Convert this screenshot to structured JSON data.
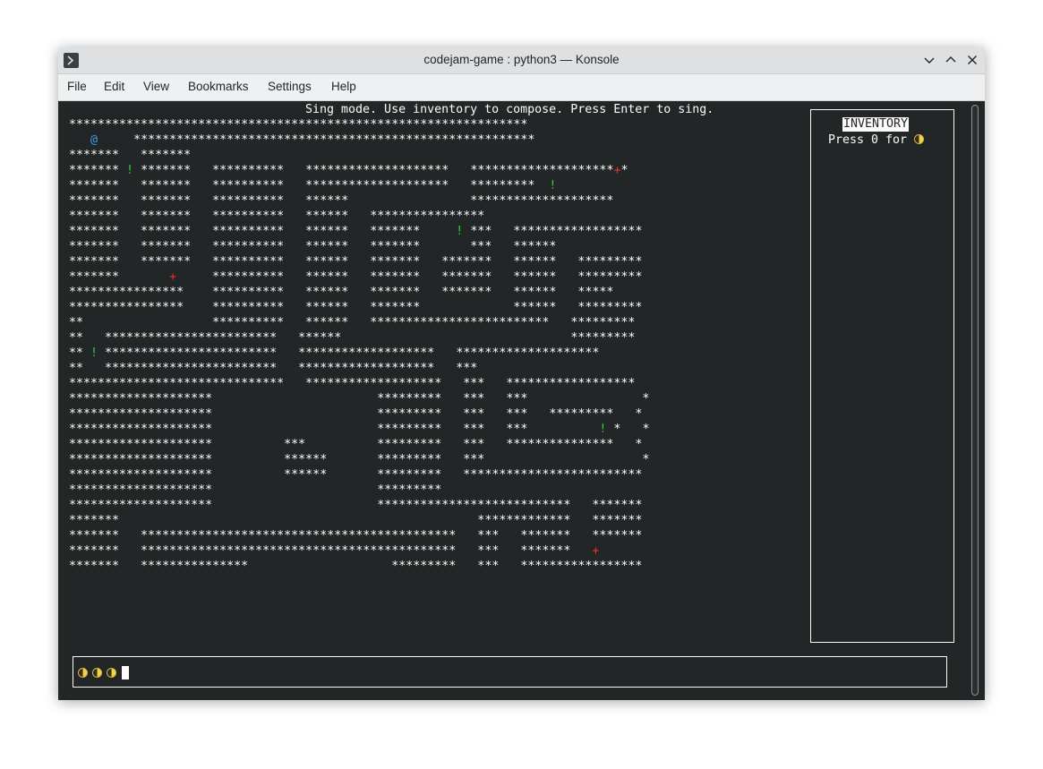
{
  "window": {
    "title": "codejam-game : python3 — Konsole",
    "buttons": [
      "minimize",
      "maximize",
      "close"
    ]
  },
  "menubar": {
    "items": [
      "File",
      "Edit",
      "View",
      "Bookmarks",
      "Settings",
      "Help"
    ]
  },
  "terminal": {
    "status_message": "Sing mode. Use inventory to compose. Press Enter to sing.",
    "map_rows": [
      "****************************************************************",
      "   @     ********************************************************",
      "*******   *******",
      "******* ! *******   **********   ********************   ********************+*",
      "*******   *******   **********   ********************   *********  !",
      "*******   *******   **********   ******                 ********************",
      "*******   *******   **********   ******   ****************",
      "*******   *******   **********   ******   *******     ! ***   ******************",
      "*******   *******   **********   ******   *******       ***   ******",
      "*******   *******   **********   ******   *******   *******   ******   *********",
      "*******       +     **********   ******   *******   *******   ******   *********",
      "****************    **********   ******   *******   *******   ******   *****",
      "****************    **********   ******   *******             ******   *********",
      "**                  **********   ******   *************************   *********",
      "**   ************************   ******                                *********",
      "** ! ************************   *******************   ********************",
      "**   ************************   *******************   ***",
      "******************************   *******************   ***   ******************",
      "********************                       *********   ***   ***                *",
      "********************                       *********   ***   ***   *********   *",
      "********************                       *********   ***   ***          ! *   *",
      "********************          ***          *********   ***   ***************   *",
      "********************          ******       *********   ***                      *",
      "********************          ******       *********   *************************",
      "********************                       *********",
      "********************                       ***************************   *******",
      "*******                                                  *************   *******",
      "*******   ********************************************   ***   *******   *******",
      "*******   ********************************************   ***   *******   +",
      "*******   ***************                    *********   ***   *****************"
    ],
    "colors": {
      "background": "#232627",
      "foreground": "#fcfcfc",
      "player": "#3b9fe6",
      "item": "#2ecc40",
      "enemy": "#e8312b",
      "note": "#f3d24a"
    },
    "glyphs": {
      "player": "@",
      "item": "!",
      "enemy": "+"
    }
  },
  "inventory": {
    "title": "INVENTORY",
    "hint": "Press 0 for",
    "hint_icon": "half-moon-note-icon"
  },
  "compose": {
    "notes_count": 3,
    "note_icon": "half-moon-note-icon"
  }
}
